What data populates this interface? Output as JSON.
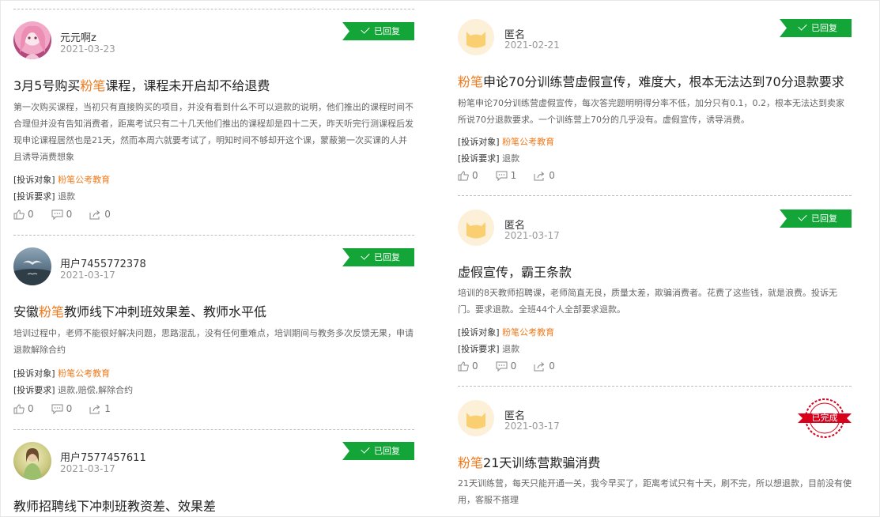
{
  "left": {
    "cards": [
      {
        "user": "元元啊z",
        "date": "2021-03-23",
        "status": "已回复",
        "title_pre": "3月5号购买",
        "title_hl": "粉笔",
        "title_post": "课程，课程未开启却不给退费",
        "desc": "第一次购买课程，当初只有直接购买的项目，并没有看到什么不可以退款的说明，他们推出的课程时间不合理但并没有告知消费者，距离考试只有二十几天他们推出的课程却是四十二天，昨天听完行测课程后发现申论课程居然也是21天，然而本周六就要考试了，明知时间不够却开这个课，蒙蔽第一次买课的人并且诱导消费想象",
        "target_label": "[投诉对象]",
        "target_org": "粉笔公考教育",
        "req_label": "[投诉要求]",
        "req_val": "退款",
        "likes": "0",
        "comments": "0",
        "shares": "0"
      },
      {
        "user": "用户7455772378",
        "date": "2021-03-17",
        "status": "已回复",
        "title_pre": "安徽",
        "title_hl": "粉笔",
        "title_post": "教师线下冲刺班效果差、教师水平低",
        "desc": "培训过程中，老师不能很好解决问题，思路混乱，没有任何重难点，培训期间与教务多次反馈无果，申请退款解除合约",
        "target_label": "[投诉对象]",
        "target_org": "粉笔公考教育",
        "req_label": "[投诉要求]",
        "req_val": "退款,赔偿,解除合约",
        "likes": "0",
        "comments": "0",
        "shares": "1"
      },
      {
        "user": "用户7577457611",
        "date": "2021-03-17",
        "status": "已回复",
        "title": "教师招聘线下冲刺班教资差、效果差"
      }
    ]
  },
  "right": {
    "cards": [
      {
        "user": "匿名",
        "date": "2021-02-21",
        "status": "已回复",
        "title_hl": "粉笔",
        "title_post": "申论70分训练营虚假宣传，难度大，根本无法达到70分退款要求",
        "desc": "粉笔申论70分训练营虚假宣传，每次答完题明明得分率不低，加分只有0.1，0.2，根本无法达到卖家所说70分退款要求。一个训练营上70分的几乎没有。虚假宣传，诱导消费。",
        "target_label": "[投诉对象]",
        "target_org": "粉笔公考教育",
        "req_label": "[投诉要求]",
        "req_val": "退款",
        "likes": "0",
        "comments": "1",
        "shares": "0"
      },
      {
        "user": "匿名",
        "date": "2021-03-17",
        "status": "已回复",
        "title": "虚假宣传，霸王条款",
        "desc": "培训的8天教师招聘课，老师简直无良，质量太差，欺骗消费者。花费了这些钱，就是浪费。投诉无门。要求退款。全班44个人全部要求退款。",
        "target_label": "[投诉对象]",
        "target_org": "粉笔公考教育",
        "req_label": "[投诉要求]",
        "req_val": "退款",
        "likes": "0",
        "comments": "0",
        "shares": "0"
      },
      {
        "user": "匿名",
        "date": "2021-03-17",
        "status": "已完成",
        "title_hl": "粉笔",
        "title_post": "21天训练营欺骗消费",
        "desc": "21天训练营，每天只能开通一关，我今早买了，距离考试只有十天，刷不完，所以想退款，目前没有使用，客服不搭理"
      }
    ]
  }
}
